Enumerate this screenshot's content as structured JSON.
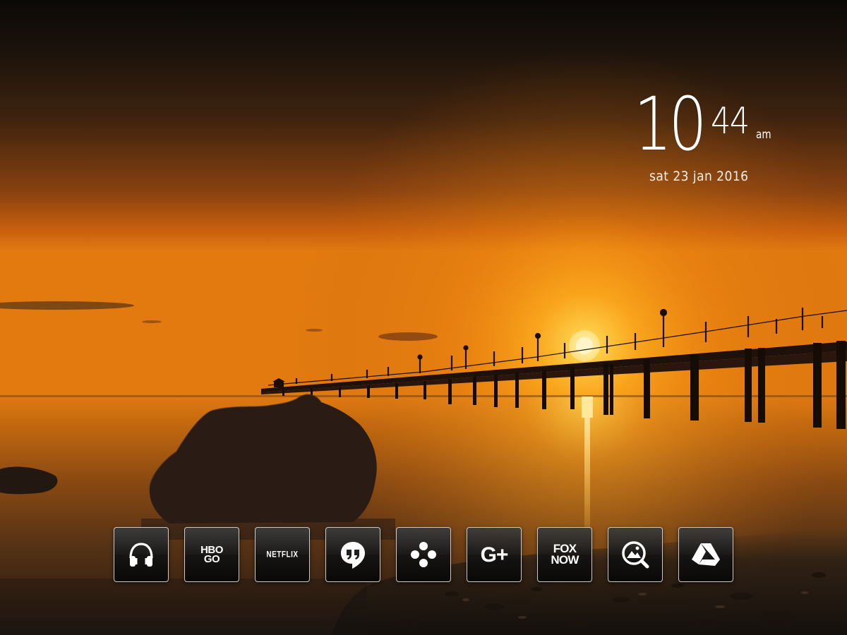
{
  "clock": {
    "hour": "10",
    "minute": "44",
    "ampm": "am",
    "date": "sat 23 jan 2016"
  },
  "dock": {
    "apps": [
      {
        "name": "Music",
        "icon": "headphones-icon"
      },
      {
        "name": "HBO GO",
        "icon": "hbo-go-logo",
        "label": "HBO\nGO"
      },
      {
        "name": "Netflix",
        "icon": "netflix-logo",
        "label": "NETFLIX"
      },
      {
        "name": "Hangouts",
        "icon": "hangouts-icon"
      },
      {
        "name": "Games",
        "icon": "gamepad-icon"
      },
      {
        "name": "Google+",
        "icon": "google-plus-icon",
        "label": "G+"
      },
      {
        "name": "FOX NOW",
        "icon": "fox-now-logo",
        "label": "FOX\nNOW"
      },
      {
        "name": "Photos",
        "icon": "photo-search-icon"
      },
      {
        "name": "Drive",
        "icon": "drive-icon"
      }
    ]
  },
  "colors": {
    "sky_top": "#0d0a08",
    "sky_mid": "#7a3c0c",
    "horizon": "#f08a10",
    "sun": "#fff3c0",
    "tile_border": "#e8e8e8",
    "text": "#ffffff"
  }
}
